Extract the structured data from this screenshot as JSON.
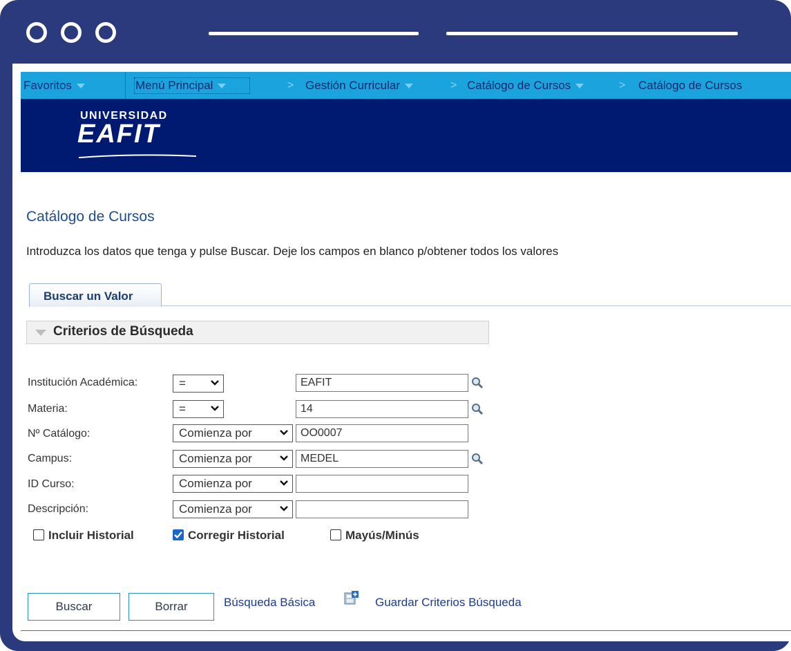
{
  "nav": {
    "favoritos": "Favoritos",
    "menu_principal": "Menú Principal",
    "gestion": "Gestión Curricular",
    "catalogo1": "Catálogo de Cursos",
    "catalogo2": "Catálogo de Cursos",
    "separator": ">"
  },
  "brand": {
    "line1": "UNIVERSIDAD",
    "line2": "EAFIT"
  },
  "page": {
    "title": "Catálogo de Cursos",
    "instructions": "Introduzca los datos que tenga y pulse Buscar. Deje los campos en blanco p/obtener todos los valores"
  },
  "tab": {
    "label": "Buscar un Valor"
  },
  "criteria": {
    "title": "Criterios de Búsqueda",
    "fields": [
      {
        "label": "Institución Académica:",
        "operator": "=",
        "value": "EAFIT"
      },
      {
        "label": "Materia:",
        "operator": "=",
        "value": "14"
      },
      {
        "label": "Nº Catálogo:",
        "operator": "Comienza por",
        "value": "OO0007"
      },
      {
        "label": "Campus:",
        "operator": "Comienza por",
        "value": "MEDEL"
      },
      {
        "label": "ID Curso:",
        "operator": "Comienza por",
        "value": ""
      },
      {
        "label": "Descripción:",
        "operator": "Comienza por",
        "value": ""
      }
    ],
    "checkboxes": [
      {
        "label": "Incluir Historial",
        "checked": false
      },
      {
        "label": "Corregir Historial",
        "checked": true
      },
      {
        "label": "Mayús/Minús",
        "checked": false
      }
    ]
  },
  "actions": {
    "buscar": "Buscar",
    "borrar": "Borrar",
    "basic_search": "Búsqueda Básica",
    "save_criteria": "Guardar Criterios Búsqueda"
  },
  "colors": {
    "frame": "#2b3a7c",
    "navbar": "#1aa3dd",
    "banner": "#001a72",
    "title": "#1d4d8c",
    "checkbox_checked": "#1b67c9"
  },
  "icons": {
    "lookup": "magnifier-icon",
    "save": "save-criteria-icon",
    "window_dots": "window-dots-icon"
  }
}
